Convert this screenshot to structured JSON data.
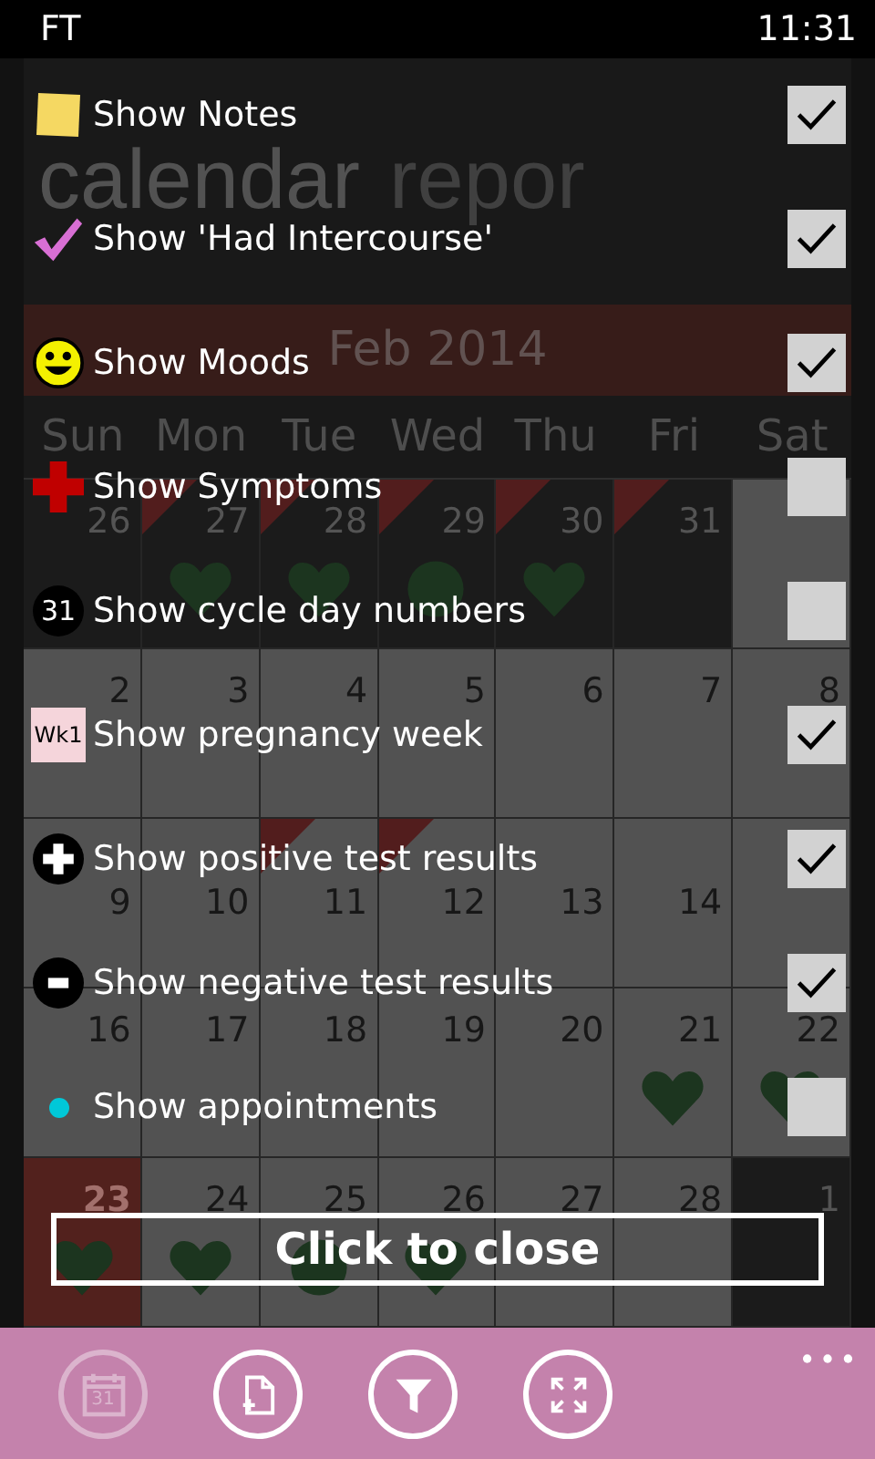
{
  "status_bar": {
    "carrier": "FT",
    "time": "11:31"
  },
  "pivot": [
    {
      "label": "calendar",
      "selected": true
    },
    {
      "label": "repor",
      "selected": false
    }
  ],
  "calendar": {
    "month": "Feb 2014",
    "weekdays": [
      "Sun",
      "Mon",
      "Tue",
      "Wed",
      "Thu",
      "Fri",
      "Sat"
    ],
    "weeks": [
      [
        {
          "day": "26",
          "kind": "other"
        },
        {
          "day": "27",
          "kind": "other",
          "flag": true,
          "heart": true
        },
        {
          "day": "28",
          "kind": "other",
          "flag": true,
          "heart": true
        },
        {
          "day": "29",
          "kind": "other",
          "flag": true,
          "circle": true
        },
        {
          "day": "30",
          "kind": "other",
          "flag": true,
          "heart": true
        },
        {
          "day": "31",
          "kind": "other",
          "flag": true
        },
        {
          "kind": "current"
        }
      ],
      [
        {
          "day": "2",
          "kind": "current"
        },
        {
          "day": "3",
          "kind": "current"
        },
        {
          "day": "4",
          "kind": "current"
        },
        {
          "day": "5",
          "kind": "current"
        },
        {
          "day": "6",
          "kind": "current"
        },
        {
          "day": "7",
          "kind": "current"
        },
        {
          "day": "8",
          "kind": "current"
        }
      ],
      [
        {
          "day": "9",
          "kind": "current"
        },
        {
          "day": "10",
          "kind": "current"
        },
        {
          "day": "11",
          "kind": "current",
          "flag": true
        },
        {
          "day": "12",
          "kind": "current",
          "flag": true
        },
        {
          "day": "13",
          "kind": "current"
        },
        {
          "day": "14",
          "kind": "current"
        },
        {
          "kind": "current"
        }
      ],
      [
        {
          "day": "16",
          "kind": "current"
        },
        {
          "day": "17",
          "kind": "current"
        },
        {
          "day": "18",
          "kind": "current"
        },
        {
          "day": "19",
          "kind": "current"
        },
        {
          "day": "20",
          "kind": "current"
        },
        {
          "day": "21",
          "kind": "current",
          "heart": true
        },
        {
          "day": "22",
          "kind": "current",
          "heart": true
        }
      ],
      [
        {
          "day": "23",
          "kind": "today",
          "heart": true
        },
        {
          "day": "24",
          "kind": "current",
          "heart": true
        },
        {
          "day": "25",
          "kind": "current",
          "circle": true
        },
        {
          "day": "26",
          "kind": "current",
          "heart": true
        },
        {
          "day": "27",
          "kind": "current"
        },
        {
          "day": "28",
          "kind": "current"
        },
        {
          "day": "1",
          "kind": "other"
        }
      ]
    ]
  },
  "options": [
    {
      "kind": "note",
      "label": "Show Notes",
      "checked": true
    },
    {
      "kind": "tick",
      "label": "Show 'Had Intercourse'",
      "checked": true
    },
    {
      "kind": "smiley",
      "label": "Show Moods",
      "checked": true
    },
    {
      "kind": "cross",
      "label": "Show Symptoms",
      "checked": false
    },
    {
      "kind": "number",
      "badge": "31",
      "label": "Show cycle day numbers",
      "checked": false
    },
    {
      "kind": "week",
      "badge": "Wk1",
      "label": "Show pregnancy week",
      "checked": true
    },
    {
      "kind": "plus",
      "label": "Show positive test results",
      "checked": true
    },
    {
      "kind": "minus",
      "label": "Show negative test results",
      "checked": true
    },
    {
      "kind": "dot",
      "label": "Show appointments",
      "checked": false
    }
  ],
  "close_button": "Click to close",
  "app_bar": [
    {
      "kind": "calendar",
      "badge": "31",
      "disabled": true
    },
    {
      "kind": "add-page",
      "disabled": false
    },
    {
      "kind": "filter",
      "disabled": false
    },
    {
      "kind": "expand",
      "disabled": false
    }
  ]
}
